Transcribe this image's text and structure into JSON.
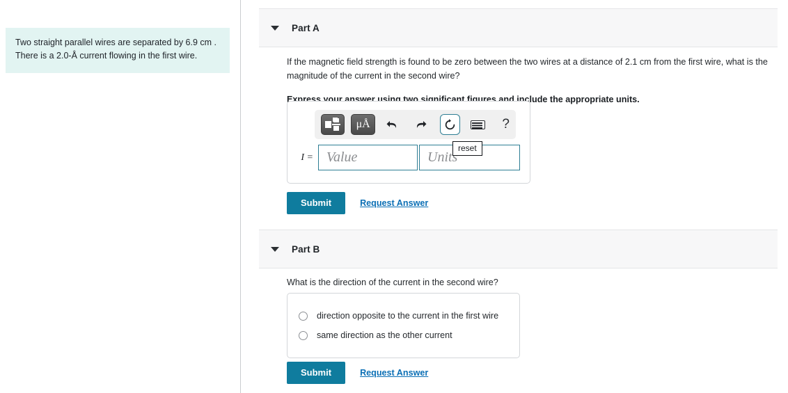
{
  "problem": {
    "text": "Two straight parallel wires are separated by 6.9  cm . There is a 2.0-Å current flowing in the first wire."
  },
  "parts": [
    {
      "id": "part-a",
      "title": "Part A",
      "caret_icon": "caret-down-icon",
      "question": "If the magnetic field strength is found to be zero between the two wires at a distance of 2.1  cm from the first wire, what is the magnitude of the current in the second wire?",
      "instruction": "Express your answer using two significant figures and include the appropriate units.",
      "answer": {
        "label": "I =",
        "value": "",
        "value_placeholder": "Value",
        "units": "",
        "units_placeholder": "Units",
        "tooltip": "reset",
        "toolbar": [
          {
            "name": "template-icon",
            "label": ""
          },
          {
            "name": "units-icon",
            "label": "μÅ"
          },
          {
            "name": "undo-icon",
            "label": ""
          },
          {
            "name": "redo-icon",
            "label": ""
          },
          {
            "name": "reset-icon",
            "label": ""
          },
          {
            "name": "keyboard-icon",
            "label": ""
          },
          {
            "name": "help-icon",
            "label": "?"
          }
        ]
      },
      "submit_label": "Submit",
      "request_answer_label": "Request Answer"
    },
    {
      "id": "part-b",
      "title": "Part B",
      "caret_icon": "caret-down-icon",
      "question": "What is the direction of the current in the second wire?",
      "options": [
        {
          "label": "direction opposite to the current in the first wire",
          "selected": false
        },
        {
          "label": "same direction as the other current",
          "selected": false
        }
      ],
      "submit_label": "Submit",
      "request_answer_label": "Request Answer"
    }
  ],
  "colors": {
    "accent_teal": "#0f7c9e",
    "link_blue": "#0b6fb5",
    "problem_bg": "#e2f4f2",
    "header_bg": "#f7f7f8",
    "field_border": "#2d7d93"
  }
}
